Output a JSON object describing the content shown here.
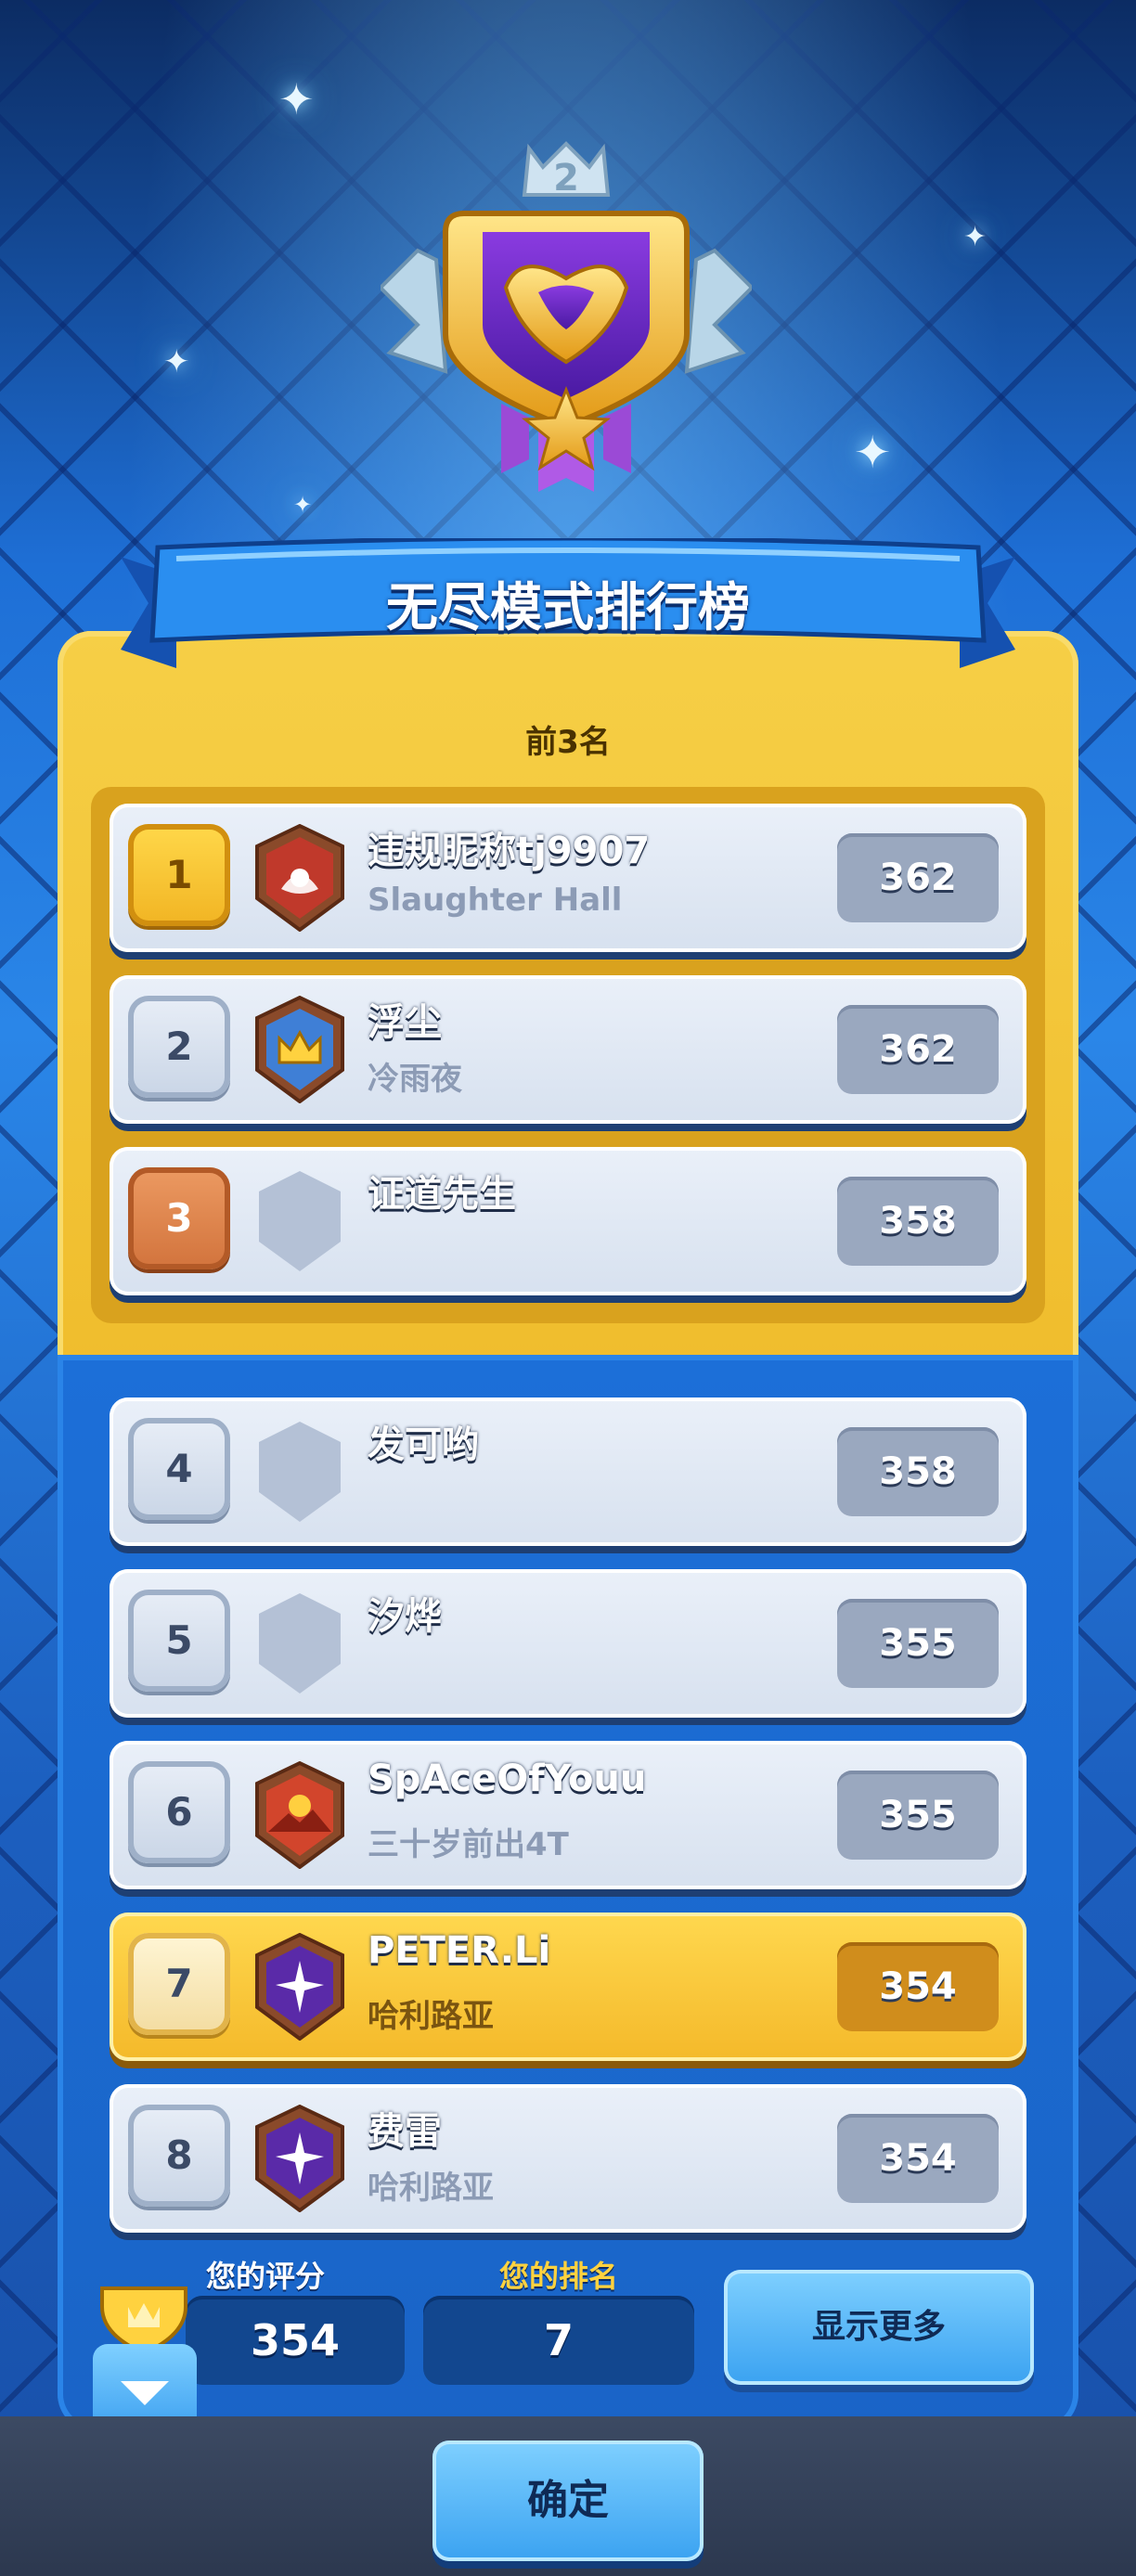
{
  "leaderboard": {
    "title": "无尽模式排行榜",
    "badge_level": "2",
    "top_label": "前3名",
    "rows": [
      {
        "rank": "1",
        "name": "违规昵称tj9907",
        "clan": "Slaughter Hall",
        "score": "362",
        "clan_icon": "lotus-icon"
      },
      {
        "rank": "2",
        "name": "浮尘",
        "clan": "冷雨夜",
        "score": "362",
        "clan_icon": "crown-icon"
      },
      {
        "rank": "3",
        "name": "证道先生",
        "clan": "",
        "score": "358",
        "clan_icon": "empty-shield-icon"
      },
      {
        "rank": "4",
        "name": "发可哟",
        "clan": "",
        "score": "358",
        "clan_icon": "empty-shield-icon"
      },
      {
        "rank": "5",
        "name": "汐烨",
        "clan": "",
        "score": "355",
        "clan_icon": "empty-shield-icon"
      },
      {
        "rank": "6",
        "name": "SpAceOfYouu",
        "clan": "三十岁前出4T",
        "score": "355",
        "clan_icon": "mountain-sun-icon"
      },
      {
        "rank": "7",
        "name": "PETER.Li",
        "clan": "哈利路亚",
        "score": "354",
        "clan_icon": "star-burst-icon"
      },
      {
        "rank": "8",
        "name": "费雷",
        "clan": "哈利路亚",
        "score": "354",
        "clan_icon": "star-burst-icon"
      }
    ]
  },
  "stats": {
    "score_label": "您的评分",
    "score_value": "354",
    "rank_label": "您的排名",
    "rank_value": "7",
    "more_button": "显示更多"
  },
  "footer": {
    "confirm_button": "确定"
  },
  "colors": {
    "gold_panel": "#f0bd2d",
    "blue_panel": "#1a64c7",
    "highlight_row": "#f4b92a"
  }
}
